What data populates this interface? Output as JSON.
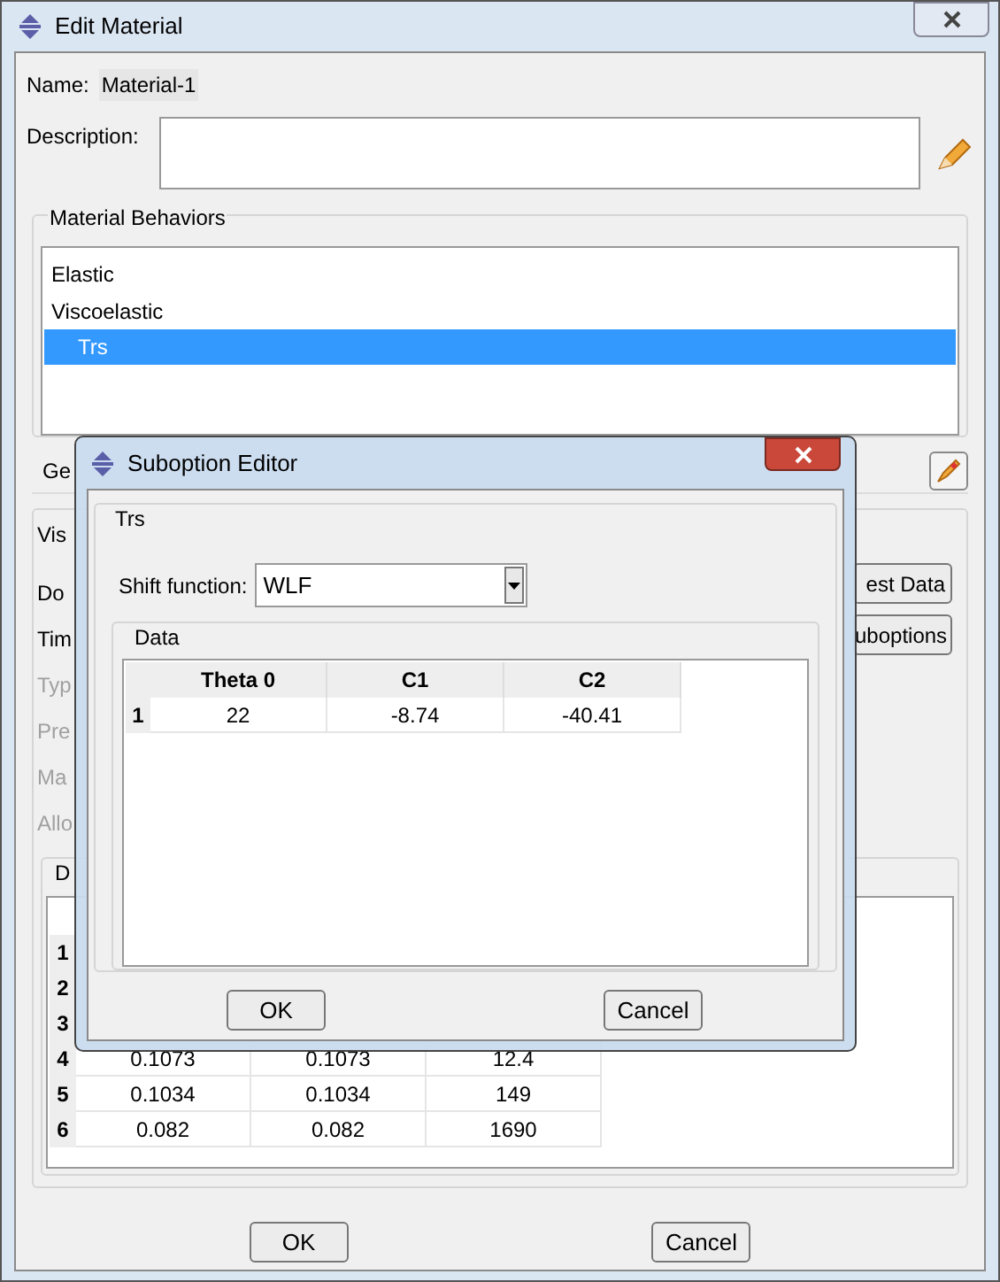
{
  "window": {
    "title": "Edit Material"
  },
  "name": {
    "label": "Name:",
    "value": "Material-1"
  },
  "description": {
    "label": "Description:"
  },
  "material_behaviors": {
    "title": "Material Behaviors",
    "items": [
      {
        "label": "Elastic",
        "selected": false
      },
      {
        "label": "Viscoelastic",
        "selected": false,
        "children": [
          {
            "label": "Trs",
            "selected": true
          }
        ]
      }
    ]
  },
  "menu_bar": [
    "Ge"
  ],
  "behavior_section": {
    "title": "Vis",
    "fields": [
      {
        "label": "Do",
        "disabled": false
      },
      {
        "label": "Tim",
        "disabled": false
      },
      {
        "label": "Typ",
        "disabled": true
      },
      {
        "label": "Pre",
        "disabled": true
      },
      {
        "label": "Ma",
        "disabled": true
      },
      {
        "label": "Allo",
        "disabled": true
      }
    ],
    "side_buttons": [
      "est Data",
      "uboptions"
    ]
  },
  "data_section": {
    "title": "D",
    "rows": [
      {
        "index": "1"
      },
      {
        "index": "2"
      },
      {
        "index": "3"
      },
      {
        "index": "4",
        "cells": [
          "0.1073",
          "0.1073",
          "12.4"
        ]
      },
      {
        "index": "5",
        "cells": [
          "0.1034",
          "0.1034",
          "149"
        ]
      },
      {
        "index": "6",
        "cells": [
          "0.082",
          "0.082",
          "1690"
        ]
      }
    ]
  },
  "buttons": [
    "OK",
    "Cancel"
  ],
  "suboption_editor": {
    "title": "Suboption Editor",
    "group": "Trs",
    "shift_function": {
      "label": "Shift function:",
      "value": "WLF"
    },
    "data": {
      "title": "Data",
      "columns": [
        "Theta 0",
        "C1",
        "C2"
      ],
      "rows": [
        {
          "index": "1",
          "cells": [
            "22",
            "-8.74",
            "-40.41"
          ]
        }
      ]
    },
    "buttons": [
      "OK",
      "Cancel"
    ]
  }
}
